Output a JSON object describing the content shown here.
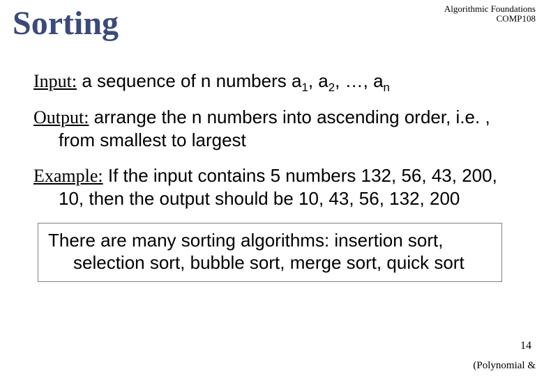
{
  "header": {
    "line1": "Algorithmic Foundations",
    "line2": "COMP108"
  },
  "title": "Sorting",
  "input": {
    "label": "Input:",
    "text_before": " a sequence of n numbers a",
    "s1": "1",
    "sep1": ", a",
    "s2": "2",
    "sep2": ", …, a",
    "s3": "n"
  },
  "output": {
    "label": "Output:",
    "text": " arrange the n numbers into ascending order, i.e. , from smallest to largest"
  },
  "example": {
    "label": "Example:",
    "text": " If the input contains 5 numbers 132, 56, 43, 200, 10, then the output should be 10, 43, 56, 132, 200"
  },
  "box": {
    "text": "There are many sorting algorithms: insertion sort, selection sort, bubble sort, merge sort, quick sort"
  },
  "pagenum": "14",
  "footer": "(Polynomial &"
}
